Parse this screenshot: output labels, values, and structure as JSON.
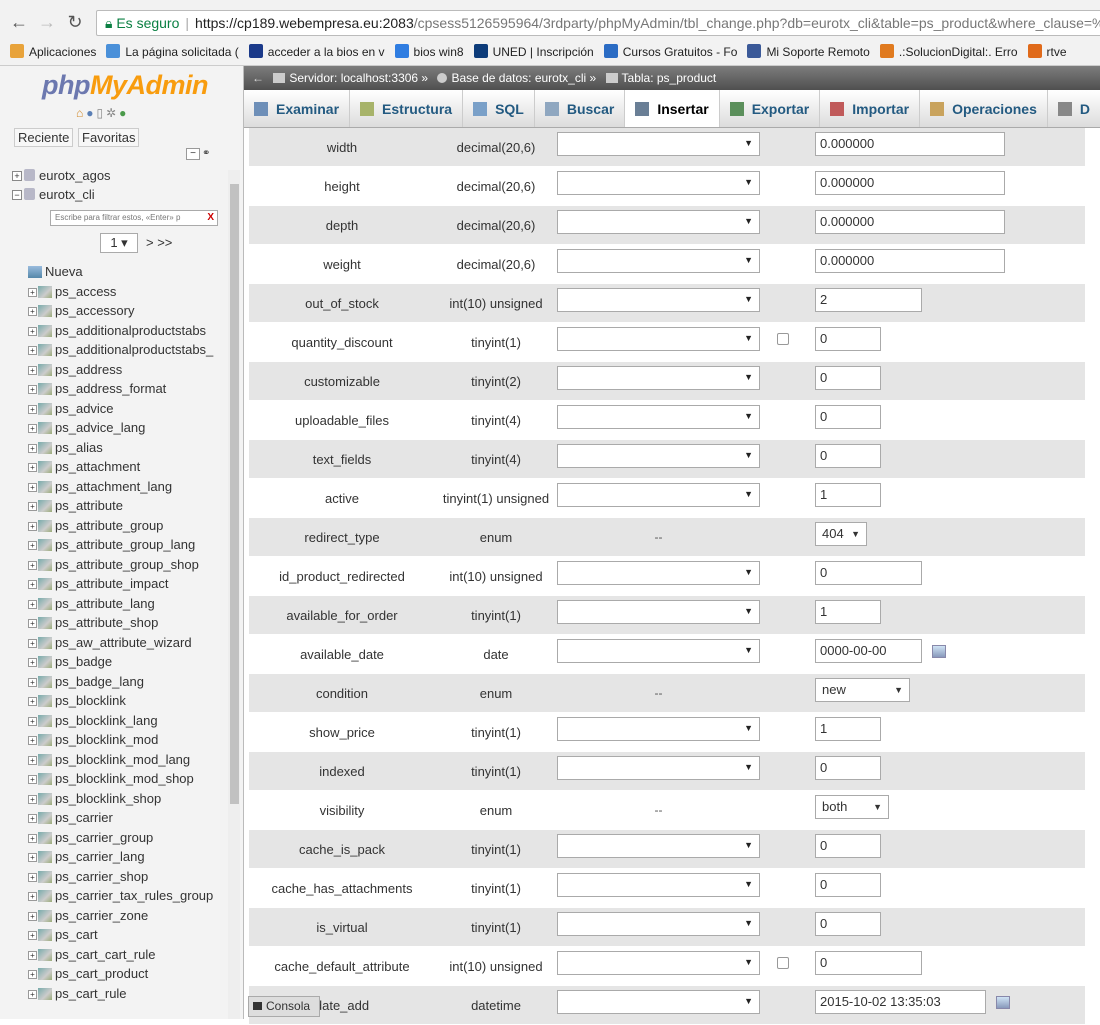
{
  "browser": {
    "secure_label": "Es seguro",
    "url_main": "https://cp189.webempresa.eu:2083",
    "url_rest": "/cpsess5126595964/3rdparty/phpMyAdmin/tbl_change.php?db=eurotx_cli&table=ps_product&where_clause=%",
    "bookmarks": [
      {
        "label": "Aplicaciones",
        "color": "#e8a33b"
      },
      {
        "label": "La página solicitada (",
        "color": "#4a90d9"
      },
      {
        "label": "acceder a la bios en v",
        "color": "#1b3a8a"
      },
      {
        "label": "bios win8",
        "color": "#2f7de1"
      },
      {
        "label": "UNED | Inscripción",
        "color": "#0d3c7a"
      },
      {
        "label": "Cursos Gratuitos - Fo",
        "color": "#2b6cc4"
      },
      {
        "label": "Mi Soporte Remoto",
        "color": "#3b5998"
      },
      {
        "label": ".:SolucionDigital:. Erro",
        "color": "#e07a1f"
      },
      {
        "label": "rtve",
        "color": "#e06a1a"
      }
    ]
  },
  "sidebar": {
    "logo_php": "php",
    "logo_myadmin": "MyAdmin",
    "tab_recent": "Reciente",
    "tab_favorites": "Favoritas",
    "databases": [
      "eurotx_agos",
      "eurotx_cli"
    ],
    "filter_placeholder": "Escribe para filtrar estos, «Enter» p",
    "filter_clear": "X",
    "page_select": "1 ▾",
    "page_next": "> >>",
    "tables": [
      "Nueva",
      "ps_access",
      "ps_accessory",
      "ps_additionalproductstabs",
      "ps_additionalproductstabs_",
      "ps_address",
      "ps_address_format",
      "ps_advice",
      "ps_advice_lang",
      "ps_alias",
      "ps_attachment",
      "ps_attachment_lang",
      "ps_attribute",
      "ps_attribute_group",
      "ps_attribute_group_lang",
      "ps_attribute_group_shop",
      "ps_attribute_impact",
      "ps_attribute_lang",
      "ps_attribute_shop",
      "ps_aw_attribute_wizard",
      "ps_badge",
      "ps_badge_lang",
      "ps_blocklink",
      "ps_blocklink_lang",
      "ps_blocklink_mod",
      "ps_blocklink_mod_lang",
      "ps_blocklink_mod_shop",
      "ps_blocklink_shop",
      "ps_carrier",
      "ps_carrier_group",
      "ps_carrier_lang",
      "ps_carrier_shop",
      "ps_carrier_tax_rules_group",
      "ps_carrier_zone",
      "ps_cart",
      "ps_cart_cart_rule",
      "ps_cart_product",
      "ps_cart_rule"
    ]
  },
  "crumb": {
    "server": "Servidor: localhost:3306",
    "database": "Base de datos: eurotx_cli",
    "table": "Tabla: ps_product"
  },
  "tabs": [
    {
      "label": "Examinar",
      "icon_color": "#6e8fb8"
    },
    {
      "label": "Estructura",
      "icon_color": "#a7b36a"
    },
    {
      "label": "SQL",
      "icon_color": "#7aa0c8"
    },
    {
      "label": "Buscar",
      "icon_color": "#8fa7c0"
    },
    {
      "label": "Insertar",
      "icon_color": "#6a7f96"
    },
    {
      "label": "Exportar",
      "icon_color": "#5b8f5b"
    },
    {
      "label": "Importar",
      "icon_color": "#c05a5a"
    },
    {
      "label": "Operaciones",
      "icon_color": "#c9a35d"
    },
    {
      "label": "D",
      "icon_color": "#888888"
    }
  ],
  "fields": [
    {
      "name": "width",
      "type": "decimal(20,6)",
      "func": "select",
      "null": false,
      "value": "0.000000",
      "w": 190
    },
    {
      "name": "height",
      "type": "decimal(20,6)",
      "func": "select",
      "null": false,
      "value": "0.000000",
      "w": 190
    },
    {
      "name": "depth",
      "type": "decimal(20,6)",
      "func": "select",
      "null": false,
      "value": "0.000000",
      "w": 190
    },
    {
      "name": "weight",
      "type": "decimal(20,6)",
      "func": "select",
      "null": false,
      "value": "0.000000",
      "w": 190
    },
    {
      "name": "out_of_stock",
      "type": "int(10) unsigned",
      "func": "select",
      "null": false,
      "value": "2",
      "w": 107
    },
    {
      "name": "quantity_discount",
      "type": "tinyint(1)",
      "func": "select",
      "null": true,
      "value": "0",
      "w": 66
    },
    {
      "name": "customizable",
      "type": "tinyint(2)",
      "func": "select",
      "null": false,
      "value": "0",
      "w": 66
    },
    {
      "name": "uploadable_files",
      "type": "tinyint(4)",
      "func": "select",
      "null": false,
      "value": "0",
      "w": 66
    },
    {
      "name": "text_fields",
      "type": "tinyint(4)",
      "func": "select",
      "null": false,
      "value": "0",
      "w": 66
    },
    {
      "name": "active",
      "type": "tinyint(1) unsigned",
      "func": "select",
      "null": false,
      "value": "1",
      "w": 66
    },
    {
      "name": "redirect_type",
      "type": "enum",
      "func": "dash",
      "null": false,
      "value": "404",
      "select": true,
      "w": 52
    },
    {
      "name": "id_product_redirected",
      "type": "int(10) unsigned",
      "func": "select",
      "null": false,
      "value": "0",
      "w": 107
    },
    {
      "name": "available_for_order",
      "type": "tinyint(1)",
      "func": "select",
      "null": false,
      "value": "1",
      "w": 66
    },
    {
      "name": "available_date",
      "type": "date",
      "func": "select",
      "null": false,
      "value": "0000-00-00",
      "w": 107,
      "cal": true
    },
    {
      "name": "condition",
      "type": "enum",
      "func": "dash",
      "null": false,
      "value": "new",
      "select": true,
      "w": 95
    },
    {
      "name": "show_price",
      "type": "tinyint(1)",
      "func": "select",
      "null": false,
      "value": "1",
      "w": 66
    },
    {
      "name": "indexed",
      "type": "tinyint(1)",
      "func": "select",
      "null": false,
      "value": "0",
      "w": 66
    },
    {
      "name": "visibility",
      "type": "enum",
      "func": "dash",
      "null": false,
      "value": "both",
      "select": true,
      "w": 74
    },
    {
      "name": "cache_is_pack",
      "type": "tinyint(1)",
      "func": "select",
      "null": false,
      "value": "0",
      "w": 66
    },
    {
      "name": "cache_has_attachments",
      "type": "tinyint(1)",
      "func": "select",
      "null": false,
      "value": "0",
      "w": 66
    },
    {
      "name": "is_virtual",
      "type": "tinyint(1)",
      "func": "select",
      "null": false,
      "value": "0",
      "w": 66
    },
    {
      "name": "cache_default_attribute",
      "type": "int(10) unsigned",
      "func": "select",
      "null": true,
      "value": "0",
      "w": 107
    },
    {
      "name": "date_add",
      "type": "datetime",
      "func": "select",
      "null": false,
      "value": "2015-10-02 13:35:03",
      "w": 171,
      "cal": true
    }
  ],
  "dash_text": "--",
  "console_label": "Consola"
}
